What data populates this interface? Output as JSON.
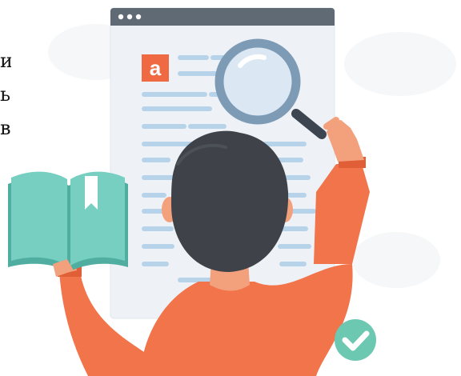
{
  "edge_text": {
    "line1": "и",
    "line2": "ь",
    "line3": "в"
  },
  "logo": {
    "letter": "a",
    "color": "#ef6a43"
  },
  "colors": {
    "page": "#eef2f6",
    "page_bar": "#5f6a75",
    "text_lines": "#b7d3ea",
    "magnifier_rim": "#7e9bb6",
    "hair": "#3f4349",
    "shirt": "#f2744a",
    "skin": "#f3a07d",
    "book_cover": "#76cfc0",
    "book_pages": "#5fbfae",
    "check_badge": "#6dc8b1"
  },
  "icons": [
    "window-dots-icon",
    "magnifier-icon",
    "book-icon",
    "checkmark-icon"
  ]
}
